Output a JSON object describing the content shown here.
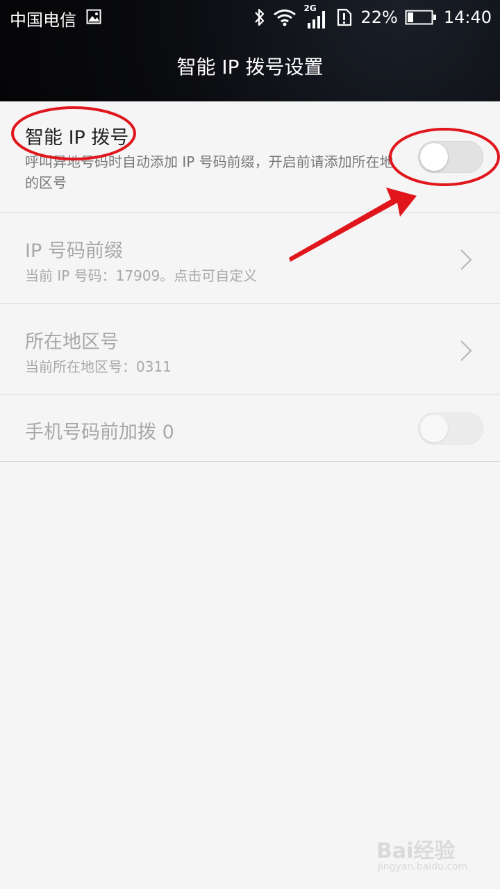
{
  "statusbar": {
    "carrier": "中国电信",
    "network": "2G",
    "battery_percent": "22%",
    "time": "14:40"
  },
  "header": {
    "title": "智能 IP 拨号设置"
  },
  "settings": {
    "smart_ip_dial": {
      "title": "智能 IP 拨号",
      "subtitle": "呼叫异地号码时自动添加 IP 号码前缀，开启前请添加所在地的区号",
      "enabled": false
    },
    "ip_prefix": {
      "title": "IP 号码前缀",
      "subtitle": "当前 IP 号码：17909。点击可自定义"
    },
    "area_code": {
      "title": "所在地区号",
      "subtitle": "当前所在地区号：0311"
    },
    "prefix_zero": {
      "title": "手机号码前加拨 0",
      "enabled": false
    }
  },
  "watermark": {
    "brand": "Bai经验",
    "url": "jingyan.baidu.com"
  },
  "colors": {
    "annotation_red": "#e0161c",
    "toggle_off": "#e2e2e2",
    "background": "#f5f5f5"
  }
}
